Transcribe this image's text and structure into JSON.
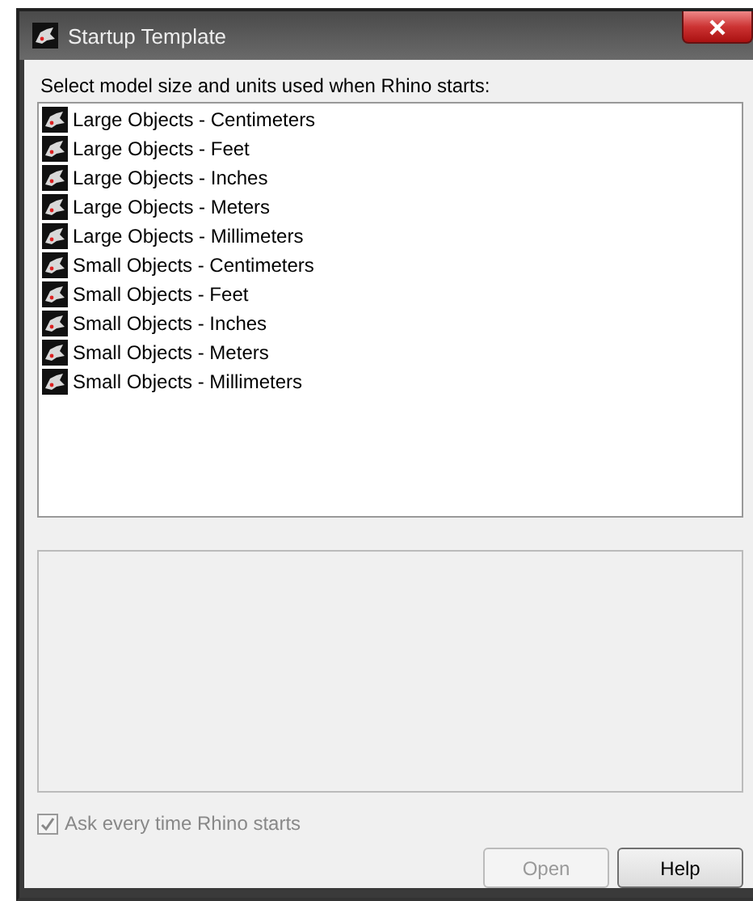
{
  "window": {
    "title": "Startup Template"
  },
  "prompt": "Select model size and units used when Rhino starts:",
  "templates": [
    {
      "label": "Large Objects - Centimeters"
    },
    {
      "label": "Large Objects - Feet"
    },
    {
      "label": "Large Objects - Inches"
    },
    {
      "label": "Large Objects - Meters"
    },
    {
      "label": "Large Objects - Millimeters"
    },
    {
      "label": "Small Objects - Centimeters"
    },
    {
      "label": "Small Objects - Feet"
    },
    {
      "label": "Small Objects - Inches"
    },
    {
      "label": "Small Objects - Meters"
    },
    {
      "label": "Small Objects - Millimeters"
    }
  ],
  "ask_checkbox": {
    "label": "Ask every time Rhino starts",
    "checked": true,
    "disabled": true
  },
  "buttons": [
    {
      "label": "Open",
      "disabled": true
    },
    {
      "label": "Help",
      "disabled": false
    }
  ]
}
